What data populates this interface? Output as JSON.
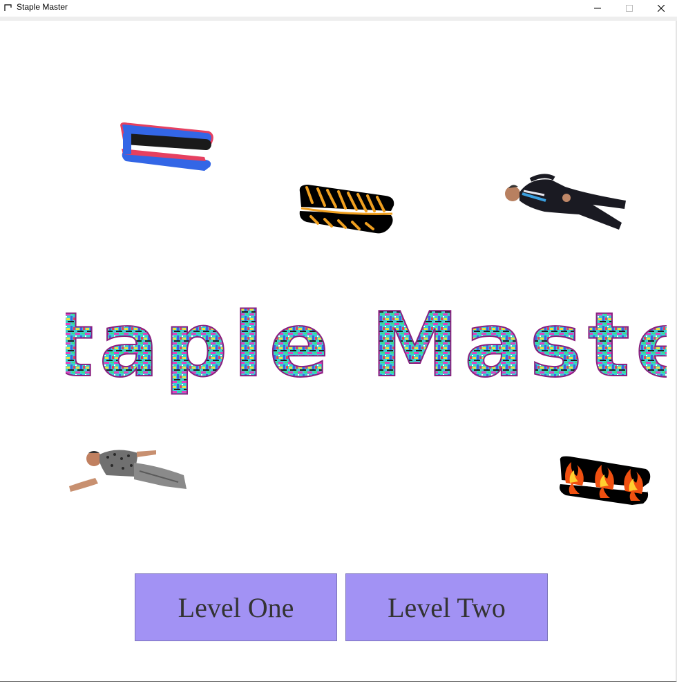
{
  "window": {
    "title": "Staple Master",
    "icon": "app-window-icon",
    "controls": [
      "minimize-icon",
      "maximize-icon",
      "close-icon"
    ]
  },
  "game": {
    "title_logo": "Staple Master",
    "sprites": [
      "stapler-blue-red",
      "stapler-black-orange",
      "man-in-suit",
      "man-in-patterned-shirt",
      "stapler-black-flames"
    ]
  },
  "buttons": {
    "level_one": "Level One",
    "level_two": "Level Two"
  },
  "colors": {
    "button_bg": "#a292f4",
    "button_text": "#333333",
    "background": "#ffffff"
  }
}
